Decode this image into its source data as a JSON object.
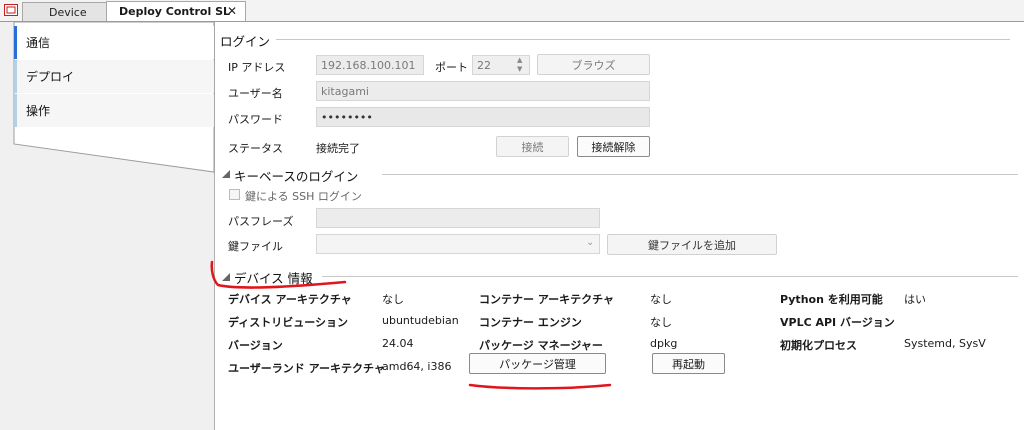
{
  "tabs": [
    {
      "label": "Device"
    },
    {
      "label": "Deploy Control SL"
    }
  ],
  "nav": {
    "items": [
      {
        "label": "通信"
      },
      {
        "label": "デプロイ"
      },
      {
        "label": "操作"
      }
    ]
  },
  "login": {
    "section_title": "ログイン",
    "ip_label": "IP アドレス",
    "ip_value": "192.168.100.101",
    "port_label": "ポート",
    "port_value": "22",
    "browse_label": "ブラウズ",
    "username_label": "ユーザー名",
    "username_value": "kitagami",
    "password_label": "パスワード",
    "password_value": "••••••••",
    "status_label": "ステータス",
    "status_value": "接続完了",
    "connect_label": "接続",
    "disconnect_label": "接続解除"
  },
  "keylogin": {
    "section_title": "キーベースのログイン",
    "ssh_checkbox_label": "鍵による SSH ログイン",
    "passphrase_label": "パスフレーズ",
    "keyfile_label": "鍵ファイル",
    "add_keyfile_label": "鍵ファイルを追加"
  },
  "device_info": {
    "section_title": "デバイス 情報",
    "arch_label": "デバイス アーキテクチャ",
    "arch_value": "なし",
    "distro_label": "ディストリビューション",
    "distro_value": "ubuntudebian",
    "version_label": "バージョン",
    "version_value": "24.04",
    "userland_label": "ユーザーランド アーキテクチャ",
    "userland_value": "amd64, i386",
    "container_arch_label": "コンテナー アーキテクチャ",
    "container_arch_value": "なし",
    "container_engine_label": "コンテナー エンジン",
    "container_engine_value": "なし",
    "pkg_manager_label": "パッケージ マネージャー",
    "pkg_manager_value": "dpkg",
    "package_mgmt_label": "パッケージ管理",
    "restart_label": "再起動",
    "python_label": "Python を利用可能",
    "python_value": "はい",
    "vplc_label": "VPLC API バージョン",
    "vplc_value": "",
    "init_label": "初期化プロセス",
    "init_value": "Systemd, SysV"
  },
  "colors": {
    "annotation": "#e0161c",
    "nav_accent": "#2a6ed8"
  }
}
